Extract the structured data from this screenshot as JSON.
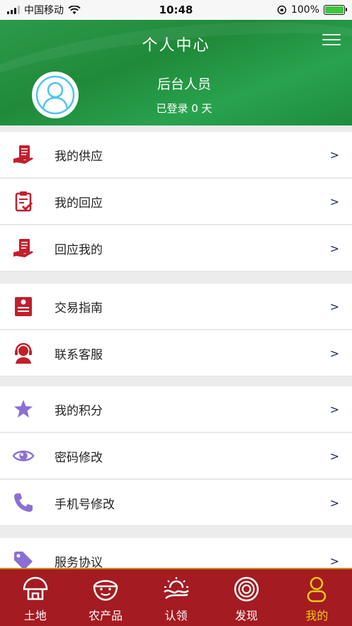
{
  "status_bar": {
    "carrier": "中国移动",
    "time": "10:48",
    "battery": "100%"
  },
  "header": {
    "title": "个人中心",
    "user_name": "后台人员",
    "login_status": "已登录 0 天",
    "menu_icon": "hamburger-icon",
    "avatar_icon": "user-avatar-icon"
  },
  "menu": {
    "arrow": ">",
    "items": [
      {
        "label": "我的供应",
        "icon": "document-hand-icon",
        "color": "#c21f2d"
      },
      {
        "label": "我的回应",
        "icon": "clipboard-check-icon",
        "color": "#c21f2d"
      },
      {
        "label": "回应我的",
        "icon": "document-hand-icon",
        "color": "#c21f2d"
      },
      {
        "label": "交易指南",
        "icon": "guide-card-icon",
        "color": "#c21f2d"
      },
      {
        "label": "联系客服",
        "icon": "headset-icon",
        "color": "#c21f2d"
      },
      {
        "label": "我的积分",
        "icon": "star-icon",
        "color": "#8b6fd6"
      },
      {
        "label": "密码修改",
        "icon": "eye-icon",
        "color": "#8b6fd6"
      },
      {
        "label": "手机号修改",
        "icon": "phone-icon",
        "color": "#8b6fd6"
      },
      {
        "label": "服务协议",
        "icon": "tag-icon",
        "color": "#8b6fd6"
      }
    ]
  },
  "tabbar": {
    "active_color": "#f0c814",
    "background": "#a41b22",
    "tabs": [
      {
        "label": "土地",
        "icon": "mushroom-house-icon",
        "active": false
      },
      {
        "label": "农产品",
        "icon": "smiley-bowl-icon",
        "active": false
      },
      {
        "label": "认领",
        "icon": "sunrise-field-icon",
        "active": false
      },
      {
        "label": "发现",
        "icon": "target-rings-icon",
        "active": false
      },
      {
        "label": "我的",
        "icon": "person-icon",
        "active": true
      }
    ]
  }
}
